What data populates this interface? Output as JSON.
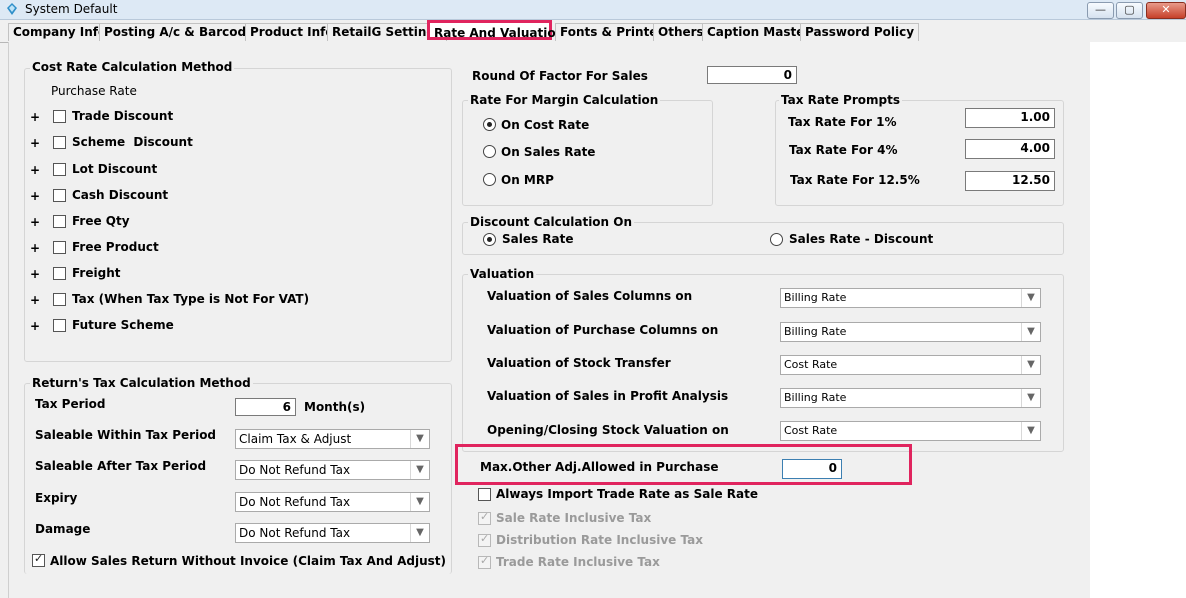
{
  "window": {
    "title": "System Default",
    "minimize": "—",
    "maximize": "▢",
    "close": "✕"
  },
  "tabs": [
    "Company Info",
    "Posting A/c & Barcodes",
    "Product Info",
    "RetailG Settings",
    "Rate And Valuation",
    "Fonts & Printers",
    "Others",
    "Caption Master",
    "Password Policy"
  ],
  "active_tab": "Rate And Valuation",
  "cost_rate": {
    "title": "Cost Rate Calculation Method",
    "subtitle": "Purchase Rate",
    "items": [
      "Trade Discount",
      "Scheme  Discount",
      "Lot Discount",
      "Cash Discount",
      "Free Qty",
      "Free Product",
      "Freight",
      "Tax (When Tax Type is Not For VAT)",
      "Future Scheme"
    ]
  },
  "returns_tax": {
    "title": "Return's Tax Calculation Method",
    "tax_period_label": "Tax Period",
    "tax_period_value": "6",
    "tax_period_unit": "Month(s)",
    "rows": [
      {
        "label": "Saleable  Within Tax Period",
        "value": "Claim Tax & Adjust"
      },
      {
        "label": "Saleable  After Tax Period",
        "value": "Do Not Refund Tax"
      },
      {
        "label": "Expiry",
        "value": "Do Not Refund Tax"
      },
      {
        "label": "Damage",
        "value": "Do Not Refund Tax"
      }
    ],
    "allow_return_label": "Allow Sales Return Without Invoice (Claim Tax And Adjust)"
  },
  "round_factor": {
    "label": "Round Of Factor For Sales",
    "value": "0"
  },
  "margin": {
    "title": "Rate For Margin Calculation",
    "options": [
      "On Cost Rate",
      "On Sales Rate",
      "On MRP"
    ],
    "selected": "On Cost Rate"
  },
  "tax_prompts": {
    "title": "Tax Rate Prompts",
    "rows": [
      {
        "label": "Tax Rate For 1%",
        "value": "1.00"
      },
      {
        "label": "Tax Rate For 4%",
        "value": "4.00"
      },
      {
        "label": "Tax Rate For 12.5%",
        "value": "12.50"
      }
    ]
  },
  "discount_calc": {
    "title": "Discount Calculation On",
    "options": [
      "Sales Rate",
      "Sales Rate - Discount"
    ],
    "selected": "Sales Rate"
  },
  "valuation": {
    "title": "Valuation",
    "rows": [
      {
        "label": "Valuation of Sales Columns on",
        "value": "Billing Rate"
      },
      {
        "label": "Valuation of Purchase Columns on",
        "value": "Billing Rate"
      },
      {
        "label": "Valuation of Stock Transfer",
        "value": "Cost Rate"
      },
      {
        "label": "Valuation of Sales in Profit Analysis",
        "value": "Billing Rate"
      },
      {
        "label": "Opening/Closing Stock Valuation on",
        "value": "Cost Rate"
      }
    ]
  },
  "max_other_adj": {
    "label": "Max.Other Adj.Allowed in Purchase",
    "value": "0"
  },
  "options_bottom": {
    "always_import": "Always Import Trade Rate as Sale Rate",
    "sale_rate_incl": "Sale Rate Inclusive Tax",
    "dist_rate_incl": "Distribution Rate Inclusive Tax",
    "trade_rate_incl": "Trade Rate Inclusive Tax"
  },
  "colors": {
    "highlight": "#e0245e",
    "titlebar": "#dde9f5"
  }
}
